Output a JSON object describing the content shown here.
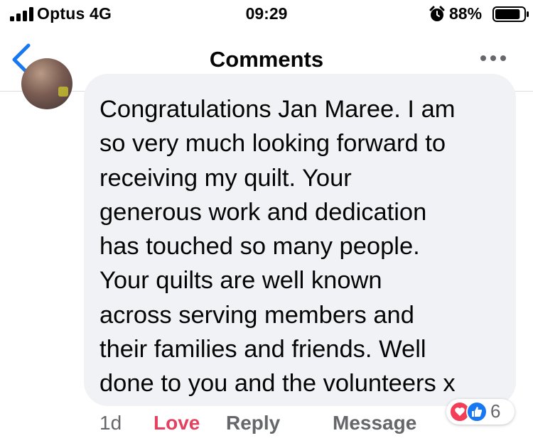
{
  "status_bar": {
    "carrier": "Optus 4G",
    "time": "09:29",
    "battery": "88%",
    "battery_level": 0.88
  },
  "header": {
    "title": "Comments"
  },
  "comment": {
    "lines": [
      "Congratulations Jan Maree. I am",
      "so very much looking forward to",
      "receiving my quilt. Your",
      "generous work and dedication",
      "has touched so many people.",
      "Your quilts are well known",
      "across serving members and",
      "their families and friends. Well",
      "done to you and the volunteers x"
    ],
    "time": "1d",
    "love_label": "Love",
    "reply_label": "Reply",
    "message_label": "Message",
    "reaction_count": "6"
  },
  "colors": {
    "accent": "#1877f2",
    "love": "#e4405f",
    "bubble": "#f0f2f5",
    "muted": "#65676b"
  },
  "icons": [
    "signal-icon",
    "alarm-icon",
    "battery-icon",
    "back-chevron-icon",
    "more-icon",
    "love-reaction-icon",
    "like-reaction-icon"
  ]
}
